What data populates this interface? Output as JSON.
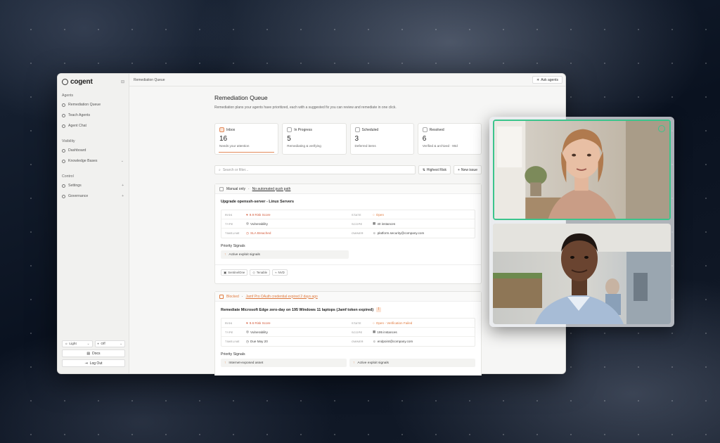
{
  "sidebar": {
    "logo": "cogent",
    "sections": {
      "agents": "Agents",
      "visibility": "Visibility",
      "control": "Control"
    },
    "items": [
      {
        "label": "Remediation Queue",
        "icon": "gear-icon"
      },
      {
        "label": "Teach Agents",
        "icon": "sparkle-icon"
      },
      {
        "label": "Agent Chat",
        "icon": "chat-icon"
      },
      {
        "label": "Dashboard",
        "icon": "dashboard-icon"
      },
      {
        "label": "Knowledge Bases",
        "icon": "database-icon"
      },
      {
        "label": "Settings",
        "icon": "settings-icon"
      },
      {
        "label": "Governance",
        "icon": "shield-icon"
      }
    ],
    "theme_select": "Light",
    "toggle_select": "Off",
    "docs_label": "Docs",
    "logout_label": "Log Out"
  },
  "topbar": {
    "breadcrumb": "Remediation Queue",
    "ask_label": "Ask agents"
  },
  "main": {
    "title": "Remediation Queue",
    "subtitle": "Remediation plans your agents have prioritized, each with a suggested fix you can review and remediate in one click.",
    "cards": [
      {
        "label": "Inbox",
        "count": "16",
        "sub": "Needs your attention"
      },
      {
        "label": "In Progress",
        "count": "5",
        "sub": "Remediating & verifying"
      },
      {
        "label": "Scheduled",
        "count": "3",
        "sub": "Deferred items"
      },
      {
        "label": "Resolved",
        "count": "6",
        "sub": "Verified & archived · 90d"
      }
    ],
    "search_placeholder": "Search or filter...",
    "sort_label": "Highest Risk",
    "new_issue_label": "New issue"
  },
  "issues": [
    {
      "status": "Manual only",
      "status_link": "No automated push path",
      "title": "Upgrade openssh-server - Linux Servers",
      "fields": {
        "risk_key": "RISK",
        "risk_val": "9.9 Risk Score",
        "state_key": "STATE",
        "state_val": "Open",
        "type_key": "TYPE",
        "type_val": "Vulnerability",
        "scope_key": "SCOPE",
        "scope_val": "40 instances",
        "timeline_key": "TIMELINE",
        "timeline_val": "SLA Breached",
        "owner_key": "OWNER",
        "owner_val": "platform.security@company.com"
      },
      "signals_label": "Priority Signals",
      "signals": [
        "Active exploit signals"
      ],
      "tags": [
        "SentinelOne",
        "Tenable",
        "NVD"
      ]
    },
    {
      "status": "Blocked",
      "status_link": "Jamf Pro OAuth credential expired 2 days ago",
      "title": "Remediate Microsoft Edge zero-day on 195 Windows 11 laptops (Jamf token expired)",
      "fields": {
        "risk_key": "RISK",
        "risk_val": "9.6 Risk Score",
        "state_key": "STATE",
        "state_val": "Open - Verification Failed",
        "type_key": "TYPE",
        "type_val": "Vulnerability",
        "scope_key": "SCOPE",
        "scope_val": "195 instances",
        "timeline_key": "TIMELINE",
        "timeline_val": "Due May 20",
        "owner_key": "OWNER",
        "owner_val": "endpoint@company.com"
      },
      "signals_label": "Priority Signals",
      "signals": [
        "Internet-exposed asset",
        "Active exploit signals"
      ]
    }
  ],
  "colors": {
    "accent": "#e07a3e",
    "active_speaker": "#3cc48c",
    "risk": "#d35a3a"
  }
}
